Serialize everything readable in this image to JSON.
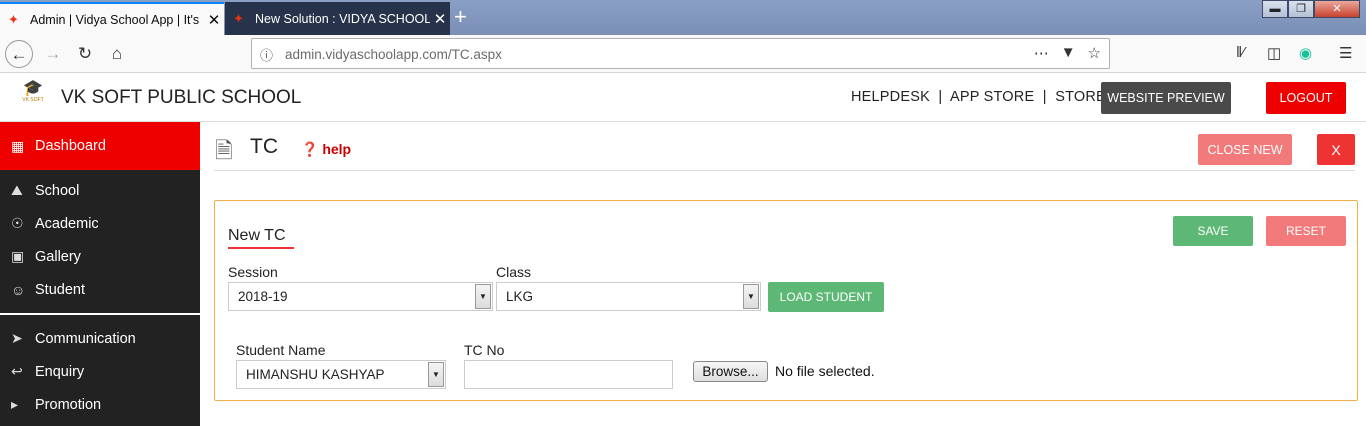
{
  "browser": {
    "tabs": [
      {
        "title": "Admin | Vidya School App | It's"
      },
      {
        "title": "New Solution : VIDYA SCHOOL"
      }
    ],
    "url": "admin.vidyaschoolapp.com/TC.aspx"
  },
  "header": {
    "school_name": "VK SOFT PUBLIC SCHOOL",
    "links": "HELPDESK  |  APP STORE  |  STORE",
    "website_preview": "WEBSITE PREVIEW",
    "logout": "LOGOUT"
  },
  "sidebar": {
    "items": [
      {
        "label": "Dashboard",
        "icon": "dashboard-icon"
      },
      {
        "label": "School",
        "icon": "school-icon"
      },
      {
        "label": "Academic",
        "icon": "globe-icon"
      },
      {
        "label": "Gallery",
        "icon": "image-icon"
      },
      {
        "label": "Student",
        "icon": "student-icon"
      },
      {
        "label": "Communication",
        "icon": "megaphone-icon"
      },
      {
        "label": "Enquiry",
        "icon": "reply-icon"
      },
      {
        "label": "Promotion",
        "icon": "bullhorn-icon"
      }
    ]
  },
  "page": {
    "title": "TC",
    "help": "help",
    "close_new": "CLOSE NEW",
    "close_x": "X"
  },
  "form": {
    "title": "New TC",
    "save": "SAVE",
    "reset": "RESET",
    "session_label": "Session",
    "session_value": "2018-19",
    "class_label": "Class",
    "class_value": "LKG",
    "load_student": "LOAD STUDENT",
    "student_name_label": "Student Name",
    "student_name_value": "HIMANSHU KASHYAP",
    "tc_no_label": "TC No",
    "tc_no_value": "",
    "browse": "Browse...",
    "file_status": "No file selected."
  },
  "colors": {
    "primary_red": "#ee0000",
    "success_green": "#5cb874",
    "light_red": "#f27a7a",
    "panel_border": "#f0ad4e",
    "sidebar_bg": "#222222"
  }
}
